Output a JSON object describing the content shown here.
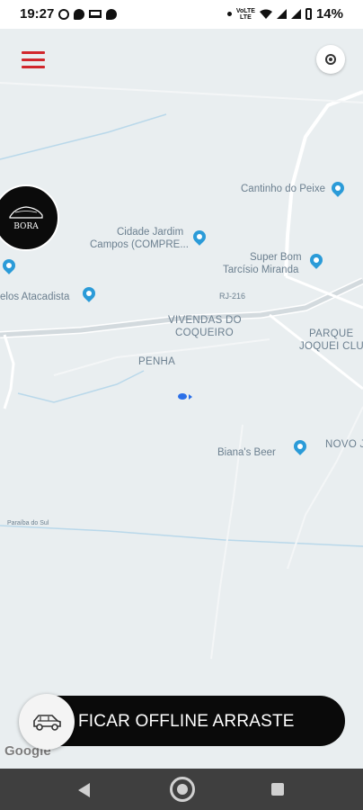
{
  "status_bar": {
    "time": "19:27",
    "left_icons": [
      "whatsapp-icon",
      "chat-bubble-icon",
      "laptop-icon",
      "chat-bubble-icon"
    ],
    "volte_top": "VoLTE",
    "volte_bottom": "LTE",
    "battery_percent": "14%"
  },
  "map": {
    "places": [
      {
        "name": "Cantinho do Peixe"
      },
      {
        "name": "Cidade Jardim",
        "line2": "Campos (COMPRE..."
      },
      {
        "name": "Super Bom",
        "line2": "Tarcísio Miranda"
      },
      {
        "name": "elos Atacadista"
      },
      {
        "name": "VIVENDAS DO",
        "line2": "COQUEIRO"
      },
      {
        "name": "PARQUE",
        "line2": "JOQUEI CLUB"
      },
      {
        "name": "PENHA"
      },
      {
        "name": "Biana's Beer"
      },
      {
        "name": "NOVO J"
      }
    ],
    "road_rj216": "RJ-216",
    "river_label": "Paraíba do Sul",
    "attribution": "Google"
  },
  "controls": {
    "menu_icon": "hamburger-menu-icon",
    "locate_icon": "my-location-icon",
    "logo_text": "BORA"
  },
  "offline_slider": {
    "label": "FICAR OFFLINE ARRASTE",
    "knob_icon": "car-icon"
  },
  "colors": {
    "menu_red": "#d1272d",
    "pin_blue": "#2b9bd8",
    "slider_bg": "#0a0a0a",
    "nav_bar": "#3f3f3f"
  }
}
